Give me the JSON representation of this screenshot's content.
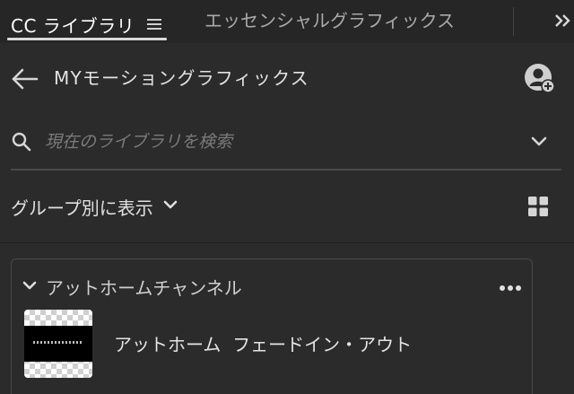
{
  "tabs": {
    "active": {
      "label": "CC ライブラリ",
      "menu_icon": "hamburger-menu-icon"
    },
    "inactive": [
      {
        "label": "エッセンシャルグラフィックス"
      }
    ],
    "overflow_icon": "double-chevron-right-icon"
  },
  "header": {
    "back_icon": "arrow-left-icon",
    "title": "MYモーショングラフィックス",
    "user_icon": "add-user-icon"
  },
  "search": {
    "icon": "search-icon",
    "placeholder": "現在のライブラリを検索",
    "value": "",
    "dropdown_icon": "chevron-down-icon"
  },
  "view": {
    "group_by_label": "グループ別に表示",
    "group_by_icon": "chevron-down-icon",
    "layout_icon": "grid-view-icon"
  },
  "groups": [
    {
      "name": "アットホームチャンネル",
      "expanded": true,
      "more_icon": "more-horizontal-icon",
      "items": [
        {
          "name": "アットホーム  フェードイン・アウト",
          "thumbnail": "video-thumbnail"
        }
      ]
    }
  ],
  "colors": {
    "background": "#2b2b2b",
    "tabbar": "#262626",
    "text_primary": "#e2e2e2",
    "text_muted": "#7a7a7a",
    "divider": "#4a4a4a"
  }
}
